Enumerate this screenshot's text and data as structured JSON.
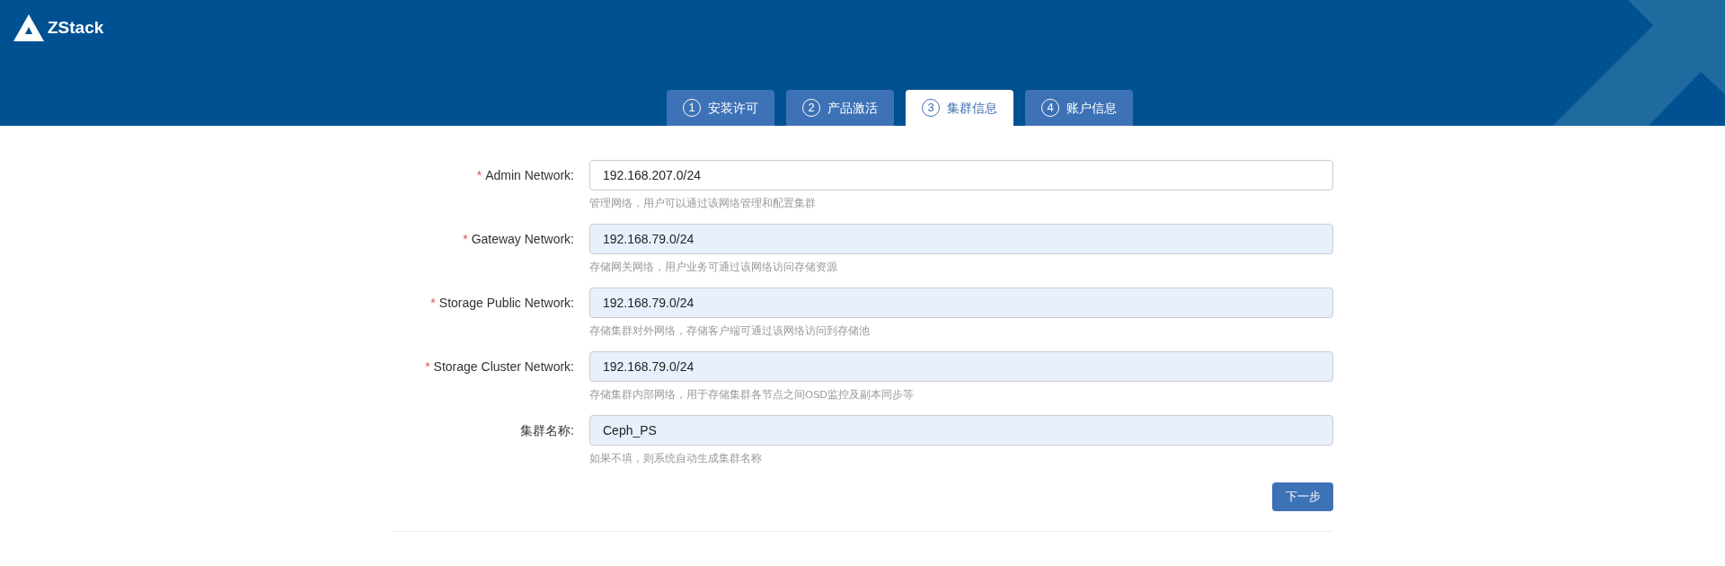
{
  "header": {
    "logo_text": "ZStack"
  },
  "tabs": [
    {
      "number": "1",
      "label": "安装许可",
      "selected": false
    },
    {
      "number": "2",
      "label": "产品激活",
      "selected": false
    },
    {
      "number": "3",
      "label": "集群信息",
      "selected": true
    },
    {
      "number": "4",
      "label": "账户信息",
      "selected": false
    }
  ],
  "form": {
    "fields": [
      {
        "label": "Admin Network:",
        "required_mark": "*",
        "value": "192.168.207.0/24",
        "autofilled": false,
        "hint": "管理网络，用户可以通过该网络管理和配置集群"
      },
      {
        "label": "Gateway Network:",
        "required_mark": "*",
        "value": "192.168.79.0/24",
        "autofilled": true,
        "hint": "存储网关网络，用户业务可通过该网络访问存储资源"
      },
      {
        "label": "Storage Public Network:",
        "required_mark": "*",
        "value": "192.168.79.0/24",
        "autofilled": true,
        "hint": "存储集群对外网络，存储客户端可通过该网络访问到存储池"
      },
      {
        "label": "Storage Cluster Network:",
        "required_mark": "*",
        "value": "192.168.79.0/24",
        "autofilled": true,
        "hint": "存储集群内部网络，用于存储集群各节点之间OSD监控及副本同步等"
      },
      {
        "label": "集群名称:",
        "value": "Ceph_PS",
        "autofilled": true,
        "hint": "如果不填，则系统自动生成集群名称"
      }
    ],
    "next_button": "下一步"
  }
}
